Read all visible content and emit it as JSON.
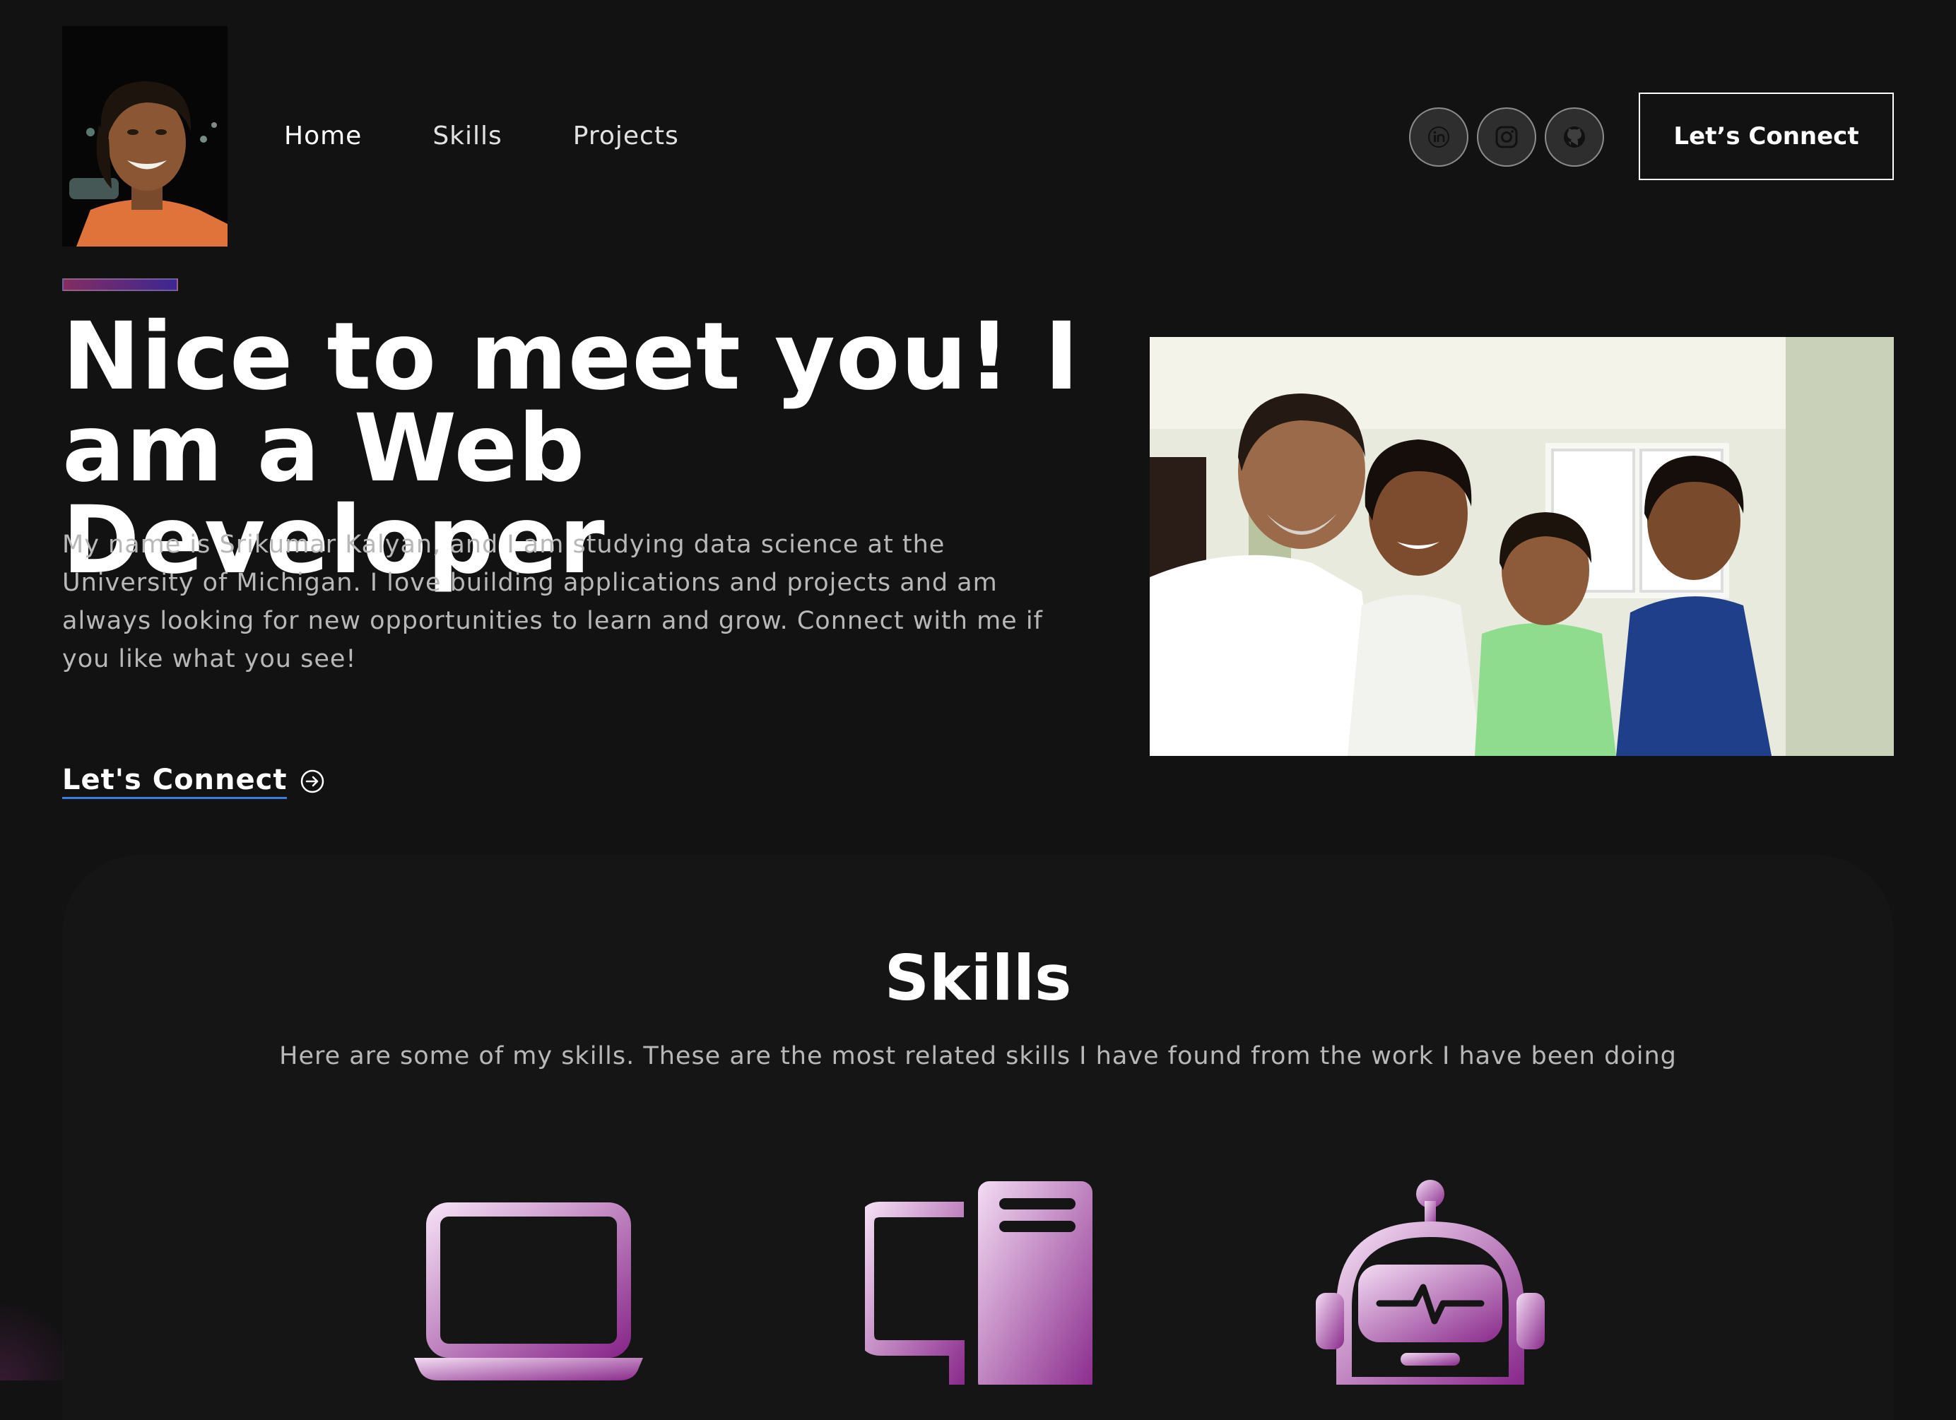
{
  "header": {
    "nav": [
      {
        "label": "Home",
        "active": true
      },
      {
        "label": "Skills",
        "active": false
      },
      {
        "label": "Projects",
        "active": false
      }
    ],
    "socials": [
      {
        "icon": "linkedin-icon"
      },
      {
        "icon": "instagram-icon"
      },
      {
        "icon": "github-icon"
      }
    ],
    "connect_label": "Let’s Connect"
  },
  "hero": {
    "title": "Nice to meet you! I am a Web Developer",
    "description": "My name is Srikumar Kalyan, and I am studying data science at the University of Michigan. I love building applications and projects and am always looking for new opportunities to learn and grow. Connect with me if you like what you see!",
    "cta_label": "Let's Connect"
  },
  "skills": {
    "title": "Skills",
    "description": "Here are some of my skills. These are the most related skills I have found from the work I have been doing",
    "icons": [
      "laptop-icon",
      "desktop-computer-icon",
      "robot-icon"
    ]
  },
  "colors": {
    "background": "#121212",
    "accent_purple": "#aa367c",
    "accent_violet": "#4a2fbd",
    "link_underline": "#3d7be0"
  }
}
